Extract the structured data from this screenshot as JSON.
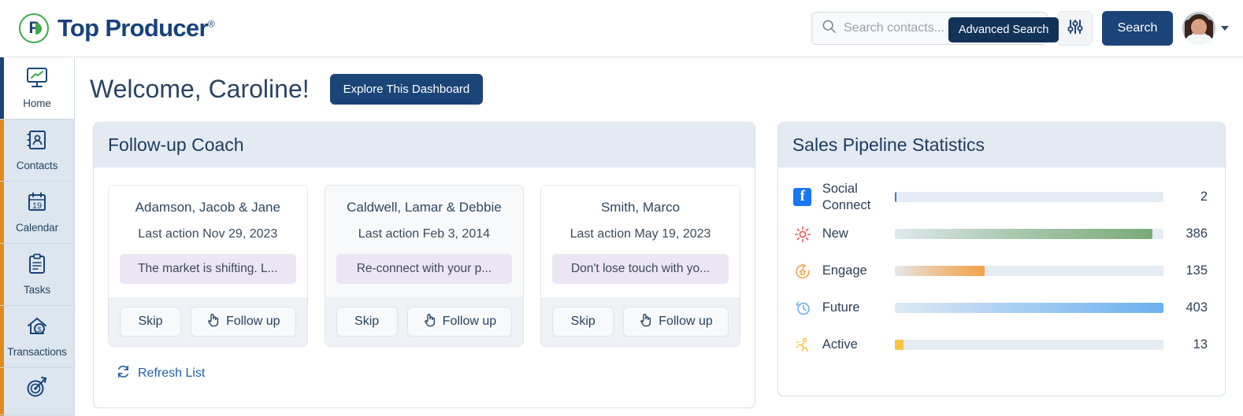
{
  "brand": {
    "name": "Top Producer",
    "registered_mark": "®",
    "logo_letter": "P",
    "green": "#3faa4b",
    "navy": "#17427c"
  },
  "topbar": {
    "search_placeholder": "Search contacts...",
    "search_value": "",
    "advanced_search_tooltip": "Advanced Search",
    "filter_icon": "sliders-icon",
    "search_button": "Search",
    "avatar_caret": "chevron-down-icon"
  },
  "sidebar": {
    "items": [
      {
        "label": "Home",
        "icon": "monitor-chart-icon",
        "active": true
      },
      {
        "label": "Contacts",
        "icon": "contact-book-icon",
        "active": false
      },
      {
        "label": "Calendar",
        "icon": "calendar-icon",
        "icon_day": "19",
        "active": false
      },
      {
        "label": "Tasks",
        "icon": "clipboard-icon",
        "active": false
      },
      {
        "label": "Transactions",
        "icon": "house-dollar-icon",
        "active": false
      },
      {
        "label": "",
        "icon": "target-arrow-icon",
        "active": false
      }
    ]
  },
  "main": {
    "welcome_title": "Welcome, Caroline!",
    "explore_button": "Explore This Dashboard"
  },
  "coach": {
    "title": "Follow-up Coach",
    "refresh_label": "Refresh List",
    "refresh_icon": "refresh-icon",
    "skip_label": "Skip",
    "follow_label": "Follow up",
    "follow_icon": "pointing-hand-icon",
    "cards": [
      {
        "name": "Adamson, Jacob & Jane",
        "last_action": "Last action Nov 29, 2023",
        "message": "The market is shifting. L...",
        "tinted": false
      },
      {
        "name": "Caldwell, Lamar & Debbie",
        "last_action": "Last action Feb 3, 2014",
        "message": "Re-connect with your p...",
        "tinted": true
      },
      {
        "name": "Smith, Marco",
        "last_action": "Last action May 19, 2023",
        "message": "Don't lose touch with yo...",
        "tinted": false
      }
    ]
  },
  "pipeline": {
    "title": "Sales Pipeline Statistics"
  },
  "chart_data": {
    "type": "bar",
    "title": "Sales Pipeline Statistics",
    "orientation": "horizontal",
    "categories": [
      "Social Connect",
      "New",
      "Engage",
      "Future",
      "Active"
    ],
    "values": [
      2,
      386,
      135,
      403,
      13
    ],
    "max": 403,
    "xlabel": "",
    "ylabel": "",
    "grid": false,
    "legend": "none",
    "series_icons": [
      "facebook-icon",
      "sun-icon",
      "house-refresh-icon",
      "clock-rewind-icon",
      "running-person-icon"
    ],
    "bar_colors": [
      "#4a78b8",
      "#7aab78",
      "#f2a24b",
      "#6bb0f0",
      "#f5c33c"
    ],
    "bar_gradients": [
      "linear-gradient(90deg, #4a78b8 0%, #4a78b8 100%)",
      "linear-gradient(90deg, rgba(122,171,120,0.05) 0%, rgba(122,171,120,0.55) 45%, #7aab78 100%)",
      "linear-gradient(90deg, rgba(242,162,75,0.05) 0%, rgba(242,162,75,0.6) 50%, #f2a24b 100%)",
      "linear-gradient(90deg, rgba(107,176,240,0.05) 0%, rgba(107,176,240,0.5) 45%, #6bb0f0 100%)",
      "linear-gradient(90deg, #f5c33c 0%, #f5c33c 100%)"
    ],
    "track_color": "#e5ecf3"
  }
}
